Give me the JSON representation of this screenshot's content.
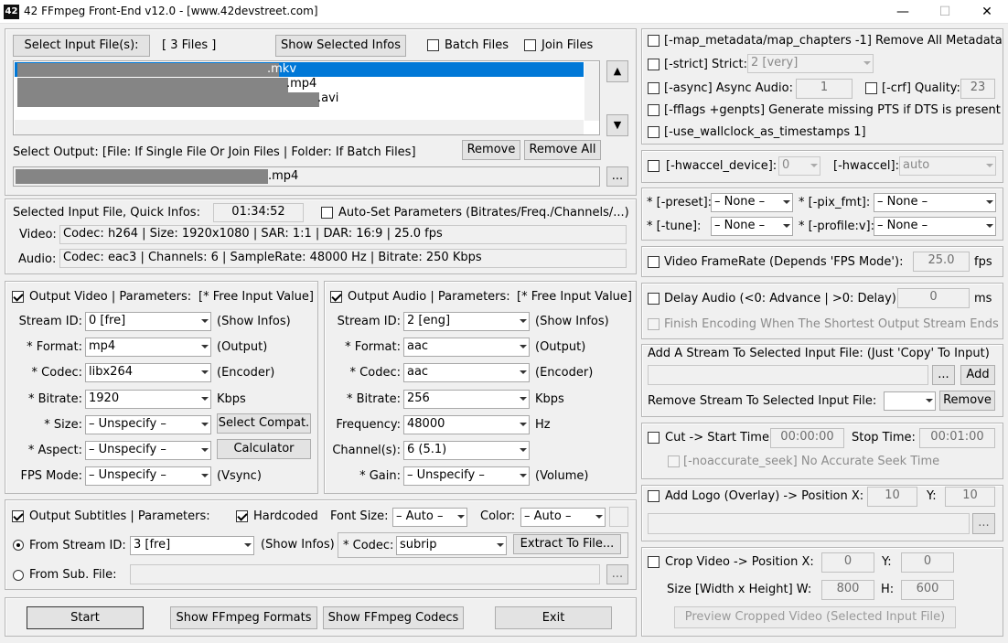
{
  "window": {
    "title": "42 FFmpeg Front-End v12.0 - [www.42devstreet.com]",
    "icon": "42",
    "minimize": "—",
    "maximize": "☐",
    "close": "✕"
  },
  "input": {
    "select_btn": "Select Input File(s):",
    "count": "[ 3 Files ]",
    "show_infos_btn": "Show Selected Infos",
    "batch": "Batch Files",
    "join": "Join Files",
    "files": [
      {
        "ext": ".mkv"
      },
      {
        "ext": ".mp4"
      },
      {
        "ext": ".avi"
      }
    ],
    "up": "▲",
    "down": "▼",
    "output_label": "Select Output: [File: If Single File Or Join Files | Folder: If Batch Files]",
    "remove": "Remove",
    "remove_all": "Remove All",
    "output_ext": ".mp4",
    "browse": "..."
  },
  "quick": {
    "label": "Selected Input File, Quick Infos:",
    "duration": "01:34:52",
    "autoset": "Auto-Set Parameters (Bitrates/Freq./Channels/...)",
    "video_label": "Video:",
    "video": "Codec: h264 | Size: 1920x1080 | SAR: 1:1 | DAR: 16:9 | 25.0 fps",
    "audio_label": "Audio:",
    "audio": "Codec: eac3 | Channels: 6 | SampleRate: 48000 Hz | Bitrate: 250 Kbps"
  },
  "video": {
    "header": "Output Video | Parameters:",
    "free": "[* Free Input Value]",
    "rows": [
      {
        "label": "Stream ID:",
        "value": "0 [fre]",
        "suffix": "(Show Infos)"
      },
      {
        "label": "* Format:",
        "value": "mp4",
        "suffix": "(Output)"
      },
      {
        "label": "* Codec:",
        "value": "libx264",
        "suffix": "(Encoder)"
      },
      {
        "label": "* Bitrate:",
        "value": "1920",
        "suffix": "Kbps"
      },
      {
        "label": "* Size:",
        "value": "– Unspecify –",
        "suffix": ""
      },
      {
        "label": "* Aspect:",
        "value": "– Unspecify –",
        "suffix": ""
      },
      {
        "label": "FPS Mode:",
        "value": "– Unspecify –",
        "suffix": "(Vsync)"
      }
    ],
    "compat_btn": "Select Compat.",
    "calc_btn": "Calculator"
  },
  "audio": {
    "header": "Output Audio | Parameters:",
    "free": "[* Free Input Value]",
    "rows": [
      {
        "label": "Stream ID:",
        "value": "2 [eng]",
        "suffix": "(Show Infos)"
      },
      {
        "label": "* Format:",
        "value": "aac",
        "suffix": "(Output)"
      },
      {
        "label": "* Codec:",
        "value": "aac",
        "suffix": "(Encoder)"
      },
      {
        "label": "* Bitrate:",
        "value": "256",
        "suffix": "Kbps"
      },
      {
        "label": "Frequency:",
        "value": "48000",
        "suffix": "Hz"
      },
      {
        "label": "Channel(s):",
        "value": "6 (5.1)",
        "suffix": ""
      },
      {
        "label": "* Gain:",
        "value": "– Unspecify –",
        "suffix": "(Volume)"
      }
    ]
  },
  "subs": {
    "header": "Output Subtitles | Parameters:",
    "hardcoded": "Hardcoded",
    "font_size_label": "Font Size:",
    "font_size": "– Auto –",
    "color_label": "Color:",
    "color": "– Auto –",
    "from_stream": "From Stream ID:",
    "stream": "3 [fre]",
    "show_infos": "(Show Infos)",
    "codec_label": "* Codec:",
    "codec": "subrip",
    "extract_btn": "Extract To File...",
    "from_file": "From Sub. File:",
    "browse": "..."
  },
  "bottom": {
    "start": "Start",
    "formats": "Show FFmpeg Formats",
    "codecs": "Show FFmpeg Codecs",
    "exit": "Exit"
  },
  "right": {
    "map_meta": "[-map_metadata/map_chapters -1] Remove All Metadata",
    "strict": "[-strict] Strict:",
    "strict_val": "2 [very]",
    "async": "[-async] Async Audio:",
    "async_val": "1",
    "crf": "[-crf] Quality:",
    "crf_val": "23",
    "fflags": "[-fflags +genpts] Generate missing PTS if DTS is present",
    "wallclock": "[-use_wallclock_as_timestamps 1]",
    "hw_device": "[-hwaccel_device]:",
    "hw_device_val": "0",
    "hwaccel": "[-hwaccel]:",
    "hwaccel_val": "auto",
    "preset": "* [-preset]:",
    "preset_val": "– None –",
    "pix_fmt": "* [-pix_fmt]:",
    "pix_fmt_val": "– None –",
    "tune": "* [-tune]:",
    "tune_val": "– None –",
    "profile": "* [-profile:v]:",
    "profile_val": "– None –",
    "framerate": "Video FrameRate (Depends 'FPS Mode'):",
    "framerate_val": "25.0",
    "fps": "fps",
    "delay": "Delay Audio (<0: Advance | >0: Delay):",
    "delay_val": "0",
    "ms": "ms",
    "shortest": "Finish Encoding When The Shortest Output Stream Ends",
    "add_stream": "Add A Stream To Selected Input File:  (Just 'Copy' To Input)",
    "browse": "...",
    "add": "Add",
    "remove_stream": "Remove Stream To Selected Input File:",
    "remove": "Remove",
    "cut": "Cut -> Start Time:",
    "start_val": "00:00:00",
    "stop": "Stop Time:",
    "stop_val": "00:01:00",
    "noaccurate": "[-noaccurate_seek] No Accurate Seek Time",
    "logo": "Add Logo (Overlay) -> Position X:",
    "logo_x": "10",
    "logo_y_label": "Y:",
    "logo_y": "10",
    "crop": "Crop Video ->  Position X:",
    "crop_x": "0",
    "crop_y_label": "Y:",
    "crop_y": "0",
    "size": "Size [Width x Height]  W:",
    "w": "800",
    "h_label": "H:",
    "h": "600",
    "preview": "Preview Cropped Video (Selected Input File)"
  }
}
